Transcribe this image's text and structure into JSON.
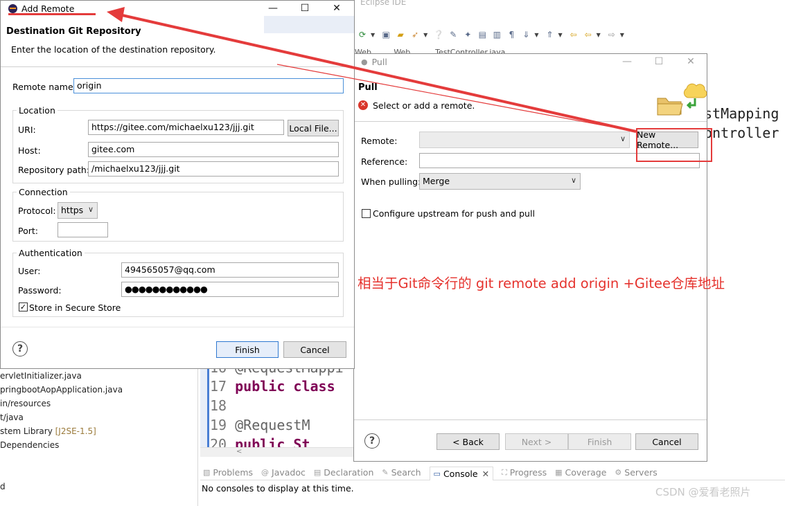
{
  "ide": {
    "window_title": "Eclipse IDE",
    "editor_tabs": [
      "Web...",
      "Web....",
      "TestController.java"
    ],
    "code_right": [
      "stMapping",
      "ontroller"
    ],
    "explorer_items": [
      {
        "text": "ervletInitializer.java",
        "tag": ""
      },
      {
        "text": "pringbootAopApplication.java",
        "tag": ""
      },
      {
        "text": "in/resources",
        "tag": ""
      },
      {
        "text": "t/java",
        "tag": ""
      },
      {
        "text": "stem Library ",
        "tag": "[J2SE-1.5]"
      },
      {
        "text": " Dependencies",
        "tag": ""
      },
      {
        "text": "d",
        "tag": ""
      }
    ],
    "editor_lines": [
      {
        "num": "16",
        "code": "@RequestMappi",
        "style": "ann"
      },
      {
        "num": "17",
        "code": "public class",
        "style": "kw"
      },
      {
        "num": "18",
        "code": "",
        "style": ""
      },
      {
        "num": "19",
        "code": "    @RequestM",
        "style": "ann"
      },
      {
        "num": "20",
        "code": "    public St",
        "style": "kw"
      }
    ],
    "console_tabs": [
      {
        "label": "Problems",
        "icon": "problems-icon",
        "active": false
      },
      {
        "label": "Javadoc",
        "icon": "javadoc-icon",
        "active": false
      },
      {
        "label": "Declaration",
        "icon": "declaration-icon",
        "active": false
      },
      {
        "label": "Search",
        "icon": "search-icon",
        "active": false
      },
      {
        "label": "Console",
        "icon": "console-icon",
        "active": true
      },
      {
        "label": "Progress",
        "icon": "progress-icon",
        "active": false
      },
      {
        "label": "Coverage",
        "icon": "coverage-icon",
        "active": false
      },
      {
        "label": "Servers",
        "icon": "servers-icon",
        "active": false
      }
    ],
    "console_message": "No consoles to display at this time."
  },
  "pull": {
    "title": "Pull",
    "header": "Pull",
    "message": "Select or add a remote.",
    "remote_label": "Remote:",
    "remote_value": "",
    "new_remote_button": "New Remote...",
    "reference_label": "Reference:",
    "reference_value": "",
    "when_pulling_label": "When pulling:",
    "when_pulling_value": "Merge",
    "configure_upstream": "Configure upstream for push and pull",
    "buttons": {
      "back": "< Back",
      "next": "Next >",
      "finish": "Finish",
      "cancel": "Cancel"
    }
  },
  "add_remote": {
    "title": "Add Remote",
    "header": "Destination Git Repository",
    "message": "Enter the location of the destination repository.",
    "remote_name_label": "Remote name:",
    "remote_name_value": "origin",
    "location": {
      "title": "Location",
      "uri_label": "URI:",
      "uri_value": "https://gitee.com/michaelxu123/jjj.git",
      "local_file_button": "Local File...",
      "host_label": "Host:",
      "host_value": "gitee.com",
      "repo_path_label": "Repository path:",
      "repo_path_value": "/michaelxu123/jjj.git"
    },
    "connection": {
      "title": "Connection",
      "protocol_label": "Protocol:",
      "protocol_value": "https",
      "port_label": "Port:",
      "port_value": ""
    },
    "authentication": {
      "title": "Authentication",
      "user_label": "User:",
      "user_value": "494565057@qq.com",
      "password_label": "Password:",
      "password_value": "●●●●●●●●●●●●",
      "store_label": "Store in Secure Store",
      "store_checked": true
    },
    "buttons": {
      "finish": "Finish",
      "cancel": "Cancel"
    }
  },
  "annotation": {
    "text": "相当于Git命令行的 git remote add origin +Gitee仓库地址",
    "color": "#e5322d"
  },
  "watermark": "CSDN @爱看老照片"
}
